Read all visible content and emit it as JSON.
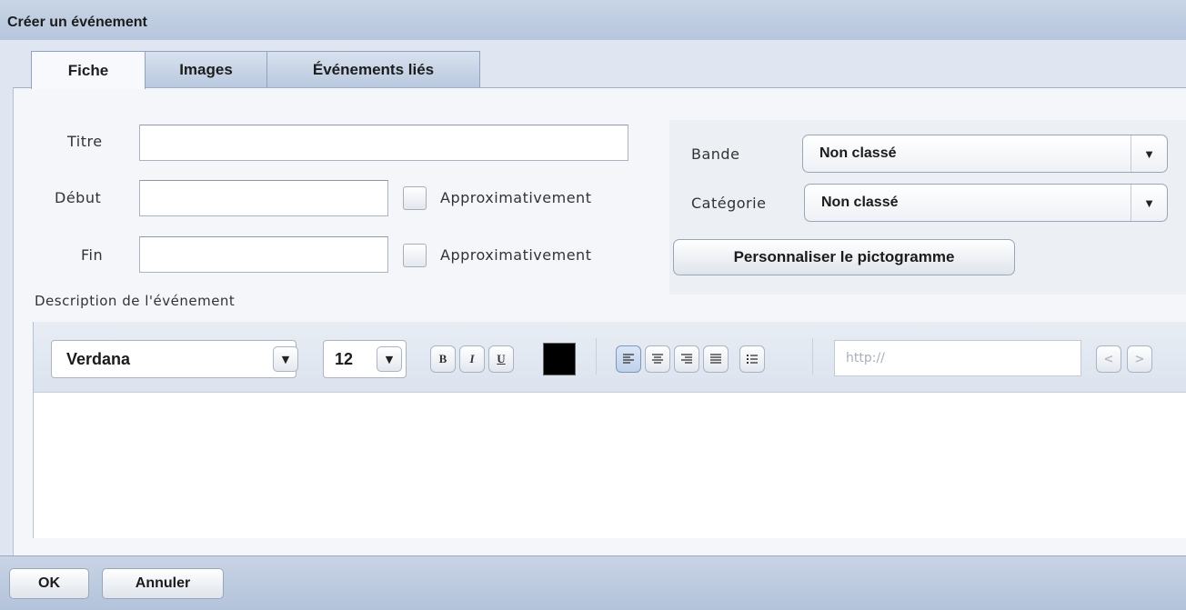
{
  "window": {
    "title": "Créer un événement"
  },
  "tabs": [
    {
      "label": "Fiche",
      "active": true
    },
    {
      "label": "Images",
      "active": false
    },
    {
      "label": "Événements liés",
      "active": false
    }
  ],
  "form": {
    "titre": {
      "label": "Titre",
      "value": ""
    },
    "debut": {
      "label": "Début",
      "value": "",
      "checkbox_label": "Approximativement",
      "checked": false
    },
    "fin": {
      "label": "Fin",
      "value": "",
      "checkbox_label": "Approximativement",
      "checked": false
    },
    "bande": {
      "label": "Bande",
      "value": "Non classé"
    },
    "categorie": {
      "label": "Catégorie",
      "value": "Non classé"
    },
    "pictogram_button": "Personnaliser le pictogramme",
    "description_label": "Description de l'événement"
  },
  "editor": {
    "font": "Verdana",
    "size": "12",
    "bold": "B",
    "italic": "I",
    "underline": "U",
    "text_color": "#000000",
    "url_placeholder": "http://",
    "content": ""
  },
  "footer": {
    "ok_label": "OK",
    "cancel_label": "Annuler"
  },
  "colors": {
    "panel": "#f4f6fa",
    "titlebar": "#b6c6dd",
    "accent": "#7f97bd"
  }
}
